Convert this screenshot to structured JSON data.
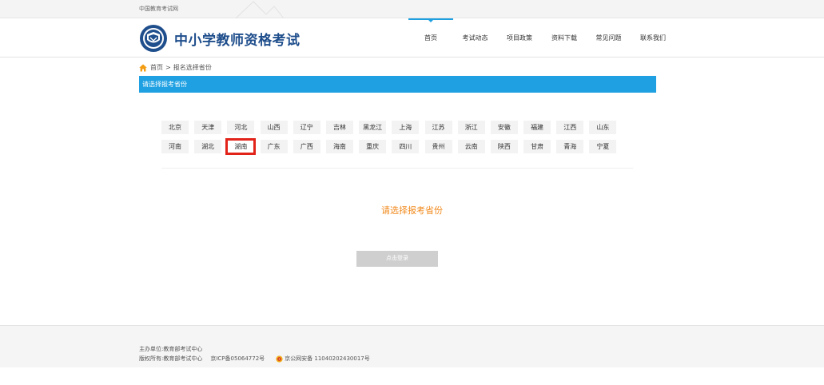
{
  "topbar": {
    "site_name": "中国教育考试网"
  },
  "header": {
    "logo_title": "中小学教师资格考试",
    "nav": [
      {
        "label": "首页",
        "active": true
      },
      {
        "label": "考试动态",
        "active": false
      },
      {
        "label": "项目政策",
        "active": false
      },
      {
        "label": "资料下载",
        "active": false
      },
      {
        "label": "常见问题",
        "active": false
      },
      {
        "label": "联系我们",
        "active": false
      }
    ]
  },
  "breadcrumb": {
    "home": "首页",
    "separator": ">",
    "current": "报名选择省份"
  },
  "section": {
    "title": "请选择报考省份"
  },
  "provinces": {
    "row1": [
      "北京",
      "天津",
      "河北",
      "山西",
      "辽宁",
      "吉林",
      "黑龙江",
      "上海",
      "江苏",
      "浙江",
      "安徽",
      "福建",
      "江西",
      "山东"
    ],
    "row2": [
      "河南",
      "湖北",
      "湖南",
      "广东",
      "广西",
      "海南",
      "重庆",
      "四川",
      "贵州",
      "云南",
      "陕西",
      "甘肃",
      "青海",
      "宁夏"
    ],
    "selected": "湖南"
  },
  "prompt": "请选择报考省份",
  "login_button": "点击登录",
  "footer": {
    "host_label": "主办单位:",
    "host": "教育部考试中心",
    "copyright_label": "版权所有:",
    "copyright": "教育部考试中心",
    "icp": "京ICP备05064772号",
    "police": "京公网安备 11040202430017号"
  },
  "colors": {
    "accent": "#1ea0e2",
    "prompt": "#f18a1d",
    "selected_border": "#e2231a",
    "logo_text": "#1f4e8c"
  }
}
